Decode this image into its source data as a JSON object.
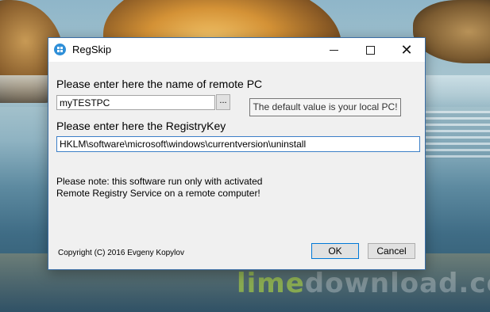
{
  "window": {
    "title": "RegSkip"
  },
  "labels": {
    "remote_pc": "Please enter here the name of remote PC",
    "registry_key": "Please enter here the RegistryKey"
  },
  "inputs": {
    "remote_pc_value": "myTESTPC",
    "registry_key_value": "HKLM\\software\\microsoft\\windows\\currentversion\\uninstall"
  },
  "browse_label": "...",
  "tooltip": "The default value is your local PC!",
  "note_line1": "Please note: this software run only with activated",
  "note_line2": "Remote Registry Service on a remote computer!",
  "copyright": "Copyright (C) 2016 Evgeny Kopylov",
  "buttons": {
    "ok": "OK",
    "cancel": "Cancel"
  },
  "watermark": {
    "prefix": "lime",
    "suffix": "download.com"
  },
  "icons": {
    "app": "regskip-app-icon",
    "minimize": "minimize-icon",
    "maximize": "maximize-icon",
    "close": "close-icon"
  }
}
